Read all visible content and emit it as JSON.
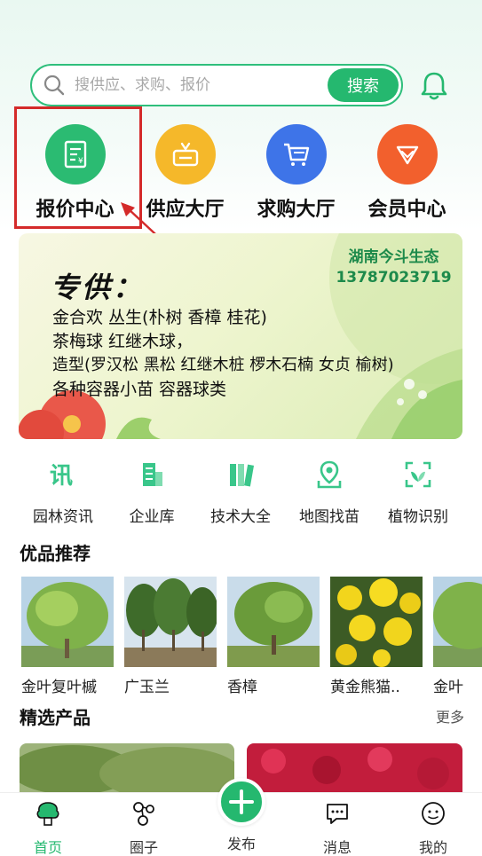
{
  "search": {
    "placeholder": "搜供应、求购、报价",
    "button_label": "搜索"
  },
  "quick_entries": [
    {
      "label": "报价中心",
      "icon": "quote-doc-icon",
      "color": "#2bbb72"
    },
    {
      "label": "供应大厅",
      "icon": "supply-box-icon",
      "color": "#f5b82a"
    },
    {
      "label": "求购大厅",
      "icon": "cart-icon",
      "color": "#3e74e8"
    },
    {
      "label": "会员中心",
      "icon": "diamond-icon",
      "color": "#f2602d"
    }
  ],
  "banner": {
    "title": "专供：",
    "lines": [
      "金合欢   丛生(朴树 香樟 桂花)",
      "茶梅球   红继木球，",
      "造型(罗汉松 黑松 红继木桩 椤木石楠 女贞 榆树)",
      "各种容器小苗   容器球类"
    ],
    "company": "湖南今斗生态",
    "phone": "13787023719"
  },
  "tools": [
    {
      "label": "园林资讯",
      "icon": "news-icon"
    },
    {
      "label": "企业库",
      "icon": "building-icon"
    },
    {
      "label": "技术大全",
      "icon": "books-icon"
    },
    {
      "label": "地图找苗",
      "icon": "map-pin-icon"
    },
    {
      "label": "植物识别",
      "icon": "plant-scan-icon"
    }
  ],
  "recommend": {
    "title": "优品推荐",
    "items": [
      {
        "label": "金叶复叶槭"
      },
      {
        "label": "广玉兰"
      },
      {
        "label": "香樟"
      },
      {
        "label": "黄金熊猫.."
      },
      {
        "label": "金叶"
      }
    ]
  },
  "products": {
    "title": "精选产品",
    "more": "更多"
  },
  "bottom_nav": [
    {
      "label": "首页",
      "icon": "home-tree-icon",
      "active": true
    },
    {
      "label": "圈子",
      "icon": "circle-network-icon"
    },
    {
      "label": "发布",
      "icon": "plus-icon"
    },
    {
      "label": "消息",
      "icon": "message-icon"
    },
    {
      "label": "我的",
      "icon": "profile-icon"
    }
  ],
  "colors": {
    "accent": "#25b86f",
    "highlight": "#d42a2a"
  }
}
